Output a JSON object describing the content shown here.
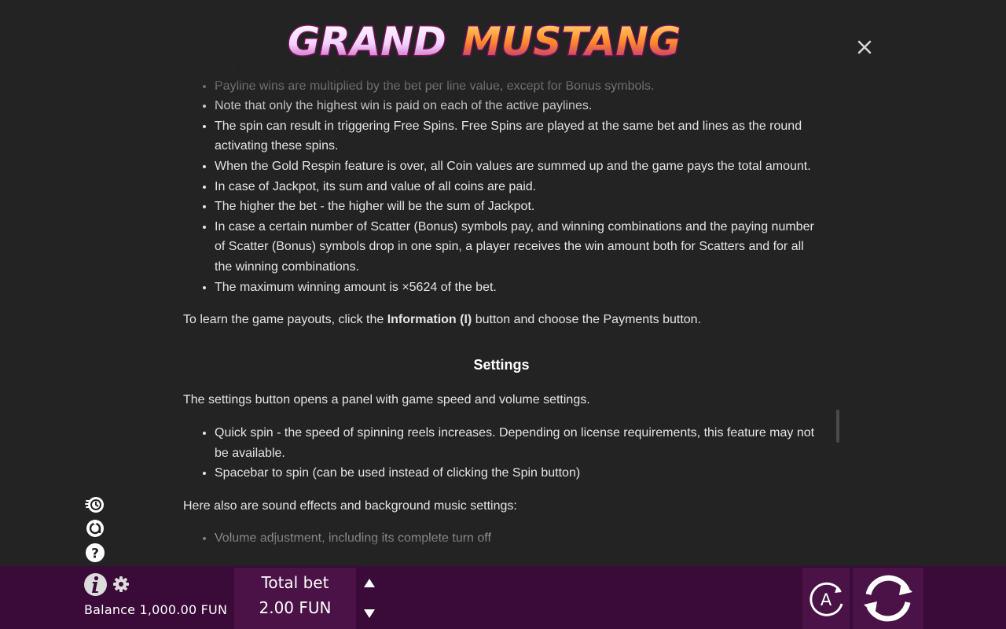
{
  "header": {
    "logo_text_1": "GRAND",
    "logo_text_2": "MUSTANG",
    "close_icon": "close-icon"
  },
  "rules": {
    "partial_top_line": "Payline wins are multiplied by the bet per line value, except for Bonus symbols.",
    "items": [
      "Payline wins are multiplied by the bet per line value, except for Bonus symbols.",
      "Note that only the highest win is paid on each of the active paylines.",
      "The spin can result in triggering Free Spins. Free Spins are played at the same bet and lines as the round activating these spins.",
      "When the Gold Respin feature is over, all Coin values are summed up and the game pays the total amount.",
      "In case of Jackpot, its sum and value of all coins are paid.",
      "The higher the bet - the higher will be the sum of Jackpot.",
      "In case a certain number of Scatter (Bonus) symbols pay, and winning combinations and the paying number of Scatter (Bonus) symbols drop in one spin, a player receives the win amount both for Scatters and for all the winning combinations.",
      "The maximum winning amount is ×5624 of the bet."
    ],
    "payouts_prefix": "To learn the game payouts, click the ",
    "payouts_bold": "Information (I)",
    "payouts_suffix": " button and choose the Payments button."
  },
  "settings": {
    "heading": "Settings",
    "intro": "The settings button opens a panel with game speed and volume settings.",
    "items": [
      "Quick spin - the speed of spinning reels increases. Depending on license requirements, this feature may not be available.",
      "Spacebar to spin (can be used instead of clicking the Spin button)"
    ],
    "sound_intro": "Here also are sound effects and background music settings:",
    "sound_items": [
      "Volume adjustment, including its complete turn off"
    ]
  },
  "side_icons": [
    "quick-spin-icon",
    "autoplay-icon",
    "help-icon"
  ],
  "bottom": {
    "balance_label": "Balance 1,000.00 FUN",
    "total_bet_label": "Total bet",
    "total_bet_value": "2.00 FUN",
    "auto_label": "A"
  },
  "colors": {
    "background": "#232323",
    "bottom_bar": "#3a0a38",
    "panel": "#4a1246",
    "text": "#e4e4e4"
  }
}
